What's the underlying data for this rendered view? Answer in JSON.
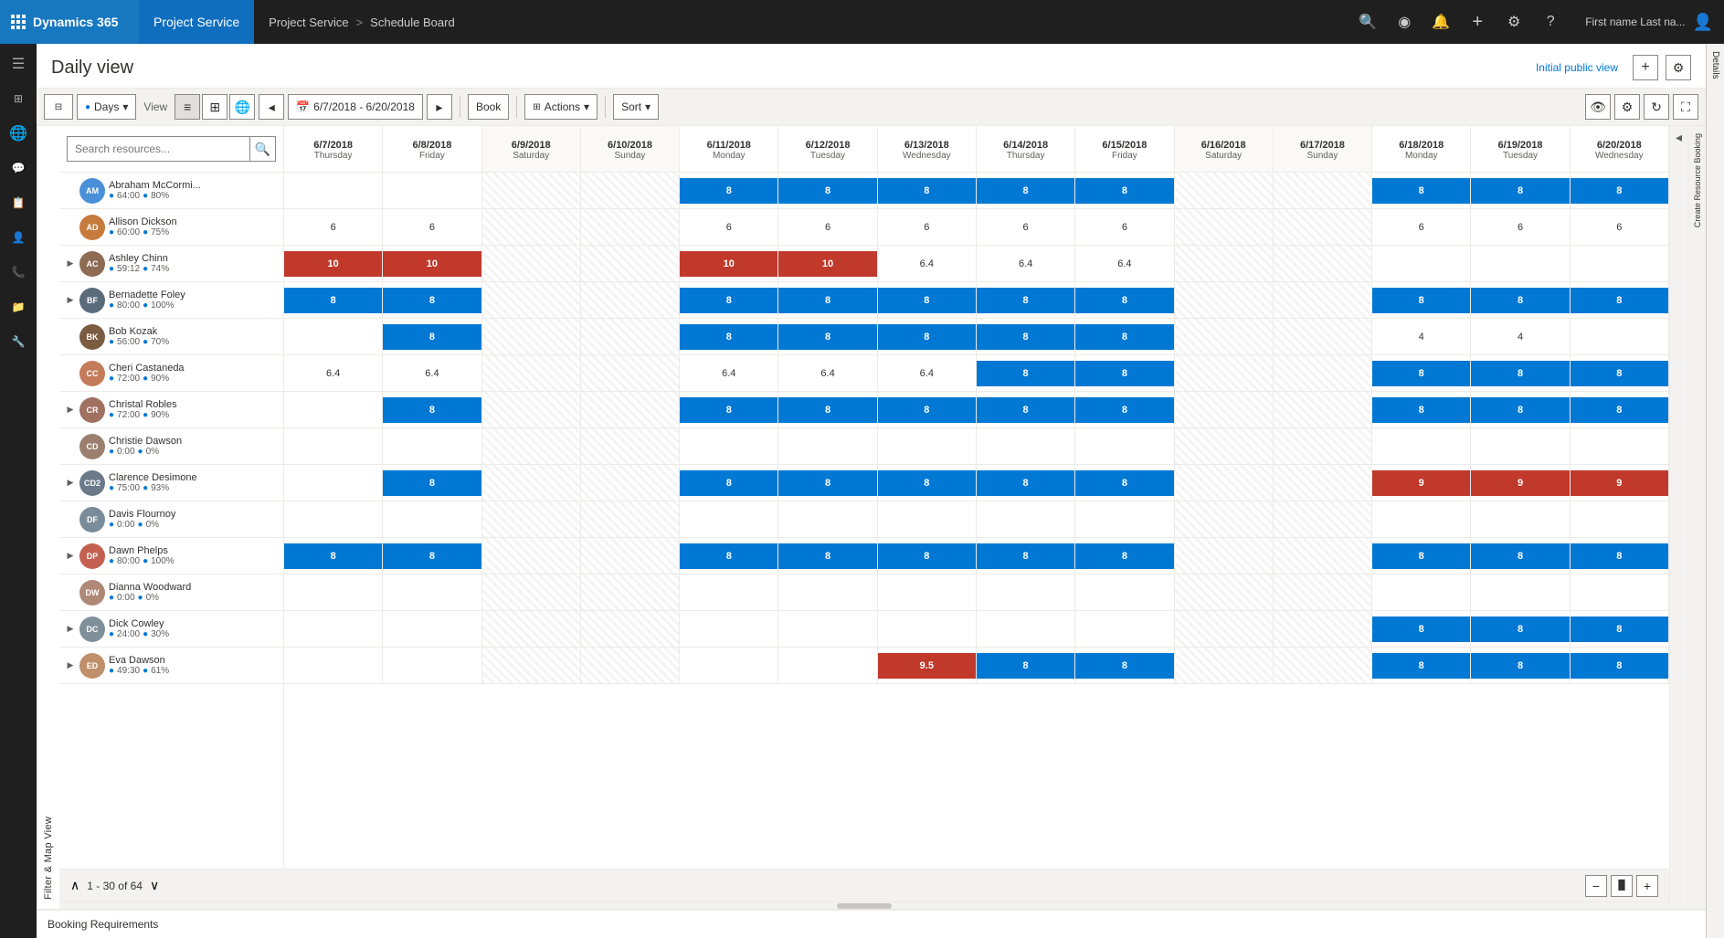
{
  "topnav": {
    "brand": "Dynamics 365",
    "module": "Project Service",
    "breadcrumb_part1": "Project Service",
    "breadcrumb_sep": ">",
    "breadcrumb_part2": "Schedule Board",
    "user": "First name Last na...",
    "icons": {
      "search": "🔍",
      "circle": "◎",
      "bell": "🔔",
      "plus": "＋",
      "gear": "⚙",
      "help": "？"
    }
  },
  "page": {
    "title": "Daily view",
    "initial_public_label": "Initial public view",
    "add_view_icon": "+",
    "settings_icon": "⚙"
  },
  "toolbar": {
    "days_label": "Days",
    "view_label": "View",
    "book_label": "Book",
    "actions_label": "Actions",
    "sort_label": "Sort",
    "date_range": "6/7/2018 - 6/20/2018"
  },
  "resource_search": {
    "placeholder": "Search resources..."
  },
  "dates": [
    {
      "date": "6/7/2018",
      "day": "Thursday",
      "weekend": false
    },
    {
      "date": "6/8/2018",
      "day": "Friday",
      "weekend": false
    },
    {
      "date": "6/9/2018",
      "day": "Saturday",
      "weekend": true
    },
    {
      "date": "6/10/2018",
      "day": "Sunday",
      "weekend": true
    },
    {
      "date": "6/11/2018",
      "day": "Monday",
      "weekend": false
    },
    {
      "date": "6/12/2018",
      "day": "Tuesday",
      "weekend": false
    },
    {
      "date": "6/13/2018",
      "day": "Wednesday",
      "weekend": false
    },
    {
      "date": "6/14/2018",
      "day": "Thursday",
      "weekend": false
    },
    {
      "date": "6/15/2018",
      "day": "Friday",
      "weekend": false
    },
    {
      "date": "6/16/2018",
      "day": "Saturday",
      "weekend": true
    },
    {
      "date": "6/17/2018",
      "day": "Sunday",
      "weekend": true
    },
    {
      "date": "6/18/2018",
      "day": "Monday",
      "weekend": false
    },
    {
      "date": "6/19/2018",
      "day": "Tuesday",
      "weekend": false
    },
    {
      "date": "6/20/2018",
      "day": "Wednesday",
      "weekend": false
    }
  ],
  "resources": [
    {
      "name": "Abraham McCormi...",
      "hours": "64:00",
      "percent": "80%",
      "initials": "AM",
      "color": "#4a90d9",
      "bookings": [
        null,
        null,
        null,
        null,
        "8",
        "8",
        "8",
        "8",
        "8",
        null,
        null,
        "8",
        "8",
        "8"
      ],
      "booking_types": [
        null,
        null,
        null,
        null,
        "blue",
        "blue",
        "blue",
        "blue",
        "blue",
        null,
        null,
        "blue",
        "blue",
        "blue"
      ],
      "has_expand": false
    },
    {
      "name": "Allison Dickson",
      "hours": "60:00",
      "percent": "75%",
      "initials": "AD",
      "color": "#c67b3c",
      "bookings": [
        "6",
        "6",
        null,
        null,
        "6",
        "6",
        "6",
        "6",
        "6",
        null,
        null,
        "6",
        "6",
        "6"
      ],
      "booking_types": [
        null,
        null,
        null,
        null,
        null,
        null,
        null,
        null,
        null,
        null,
        null,
        null,
        null,
        null
      ],
      "has_expand": false
    },
    {
      "name": "Ashley Chinn",
      "hours": "59:12",
      "percent": "74%",
      "initials": "AC",
      "color": "#8e6b52",
      "bookings": [
        "10",
        "10",
        null,
        null,
        "10",
        "10",
        "6.4",
        "6.4",
        "6.4",
        null,
        null,
        null,
        null,
        null
      ],
      "booking_types": [
        "red",
        "red",
        null,
        null,
        "red",
        "red",
        null,
        null,
        null,
        null,
        null,
        null,
        null,
        null
      ],
      "has_expand": true
    },
    {
      "name": "Bernadette Foley",
      "hours": "80:00",
      "percent": "100%",
      "initials": "BF",
      "color": "#5a6b7c",
      "bookings": [
        "8",
        "8",
        null,
        null,
        "8",
        "8",
        "8",
        "8",
        "8",
        null,
        null,
        "8",
        "8",
        "8"
      ],
      "booking_types": [
        "blue",
        "blue",
        null,
        null,
        "blue",
        "blue",
        "blue",
        "blue",
        "blue",
        null,
        null,
        "blue",
        "blue",
        "blue"
      ],
      "has_expand": true
    },
    {
      "name": "Bob Kozak",
      "hours": "56:00",
      "percent": "70%",
      "initials": "BK",
      "color": "#7a5c40",
      "bookings": [
        null,
        "8",
        null,
        null,
        "8",
        "8",
        "8",
        "8",
        "8",
        null,
        null,
        "4",
        "4",
        null
      ],
      "booking_types": [
        null,
        "blue",
        null,
        null,
        "blue",
        "blue",
        "blue",
        "blue",
        "blue",
        null,
        null,
        null,
        null,
        null
      ],
      "has_expand": false
    },
    {
      "name": "Cheri Castaneda",
      "hours": "72:00",
      "percent": "90%",
      "initials": "CC",
      "color": "#c47b5a",
      "bookings": [
        "6.4",
        "6.4",
        null,
        null,
        "6.4",
        "6.4",
        "6.4",
        "8",
        "8",
        null,
        null,
        "8",
        "8",
        "8"
      ],
      "booking_types": [
        null,
        null,
        null,
        null,
        null,
        null,
        null,
        "blue",
        "blue",
        null,
        null,
        "blue",
        "blue",
        "blue"
      ],
      "has_expand": false
    },
    {
      "name": "Christal Robles",
      "hours": "72:00",
      "percent": "90%",
      "initials": "CR",
      "color": "#a07060",
      "bookings": [
        null,
        "8",
        null,
        null,
        "8",
        "8",
        "8",
        "8",
        "8",
        null,
        null,
        "8",
        "8",
        "8"
      ],
      "booking_types": [
        null,
        "blue",
        null,
        null,
        "blue",
        "blue",
        "blue",
        "blue",
        "blue",
        null,
        null,
        "blue",
        "blue",
        "blue"
      ],
      "has_expand": true
    },
    {
      "name": "Christie Dawson",
      "hours": "0:00",
      "percent": "0%",
      "initials": "CD",
      "color": "#9b8070",
      "bookings": [
        null,
        null,
        null,
        null,
        null,
        null,
        null,
        null,
        null,
        null,
        null,
        null,
        null,
        null
      ],
      "booking_types": [
        null,
        null,
        null,
        null,
        null,
        null,
        null,
        null,
        null,
        null,
        null,
        null,
        null,
        null
      ],
      "has_expand": false
    },
    {
      "name": "Clarence Desimone",
      "hours": "75:00",
      "percent": "93%",
      "initials": "CD2",
      "color": "#6b7a8a",
      "bookings": [
        null,
        "8",
        null,
        null,
        "8",
        "8",
        "8",
        "8",
        "8",
        null,
        null,
        "9",
        "9",
        "9"
      ],
      "booking_types": [
        null,
        "blue",
        null,
        null,
        "blue",
        "blue",
        "blue",
        "blue",
        "blue",
        null,
        null,
        "red",
        "red",
        "red"
      ],
      "has_expand": true
    },
    {
      "name": "Davis Flournoy",
      "hours": "0:00",
      "percent": "0%",
      "initials": "DF",
      "color": "#7a8c9a",
      "bookings": [
        null,
        null,
        null,
        null,
        null,
        null,
        null,
        null,
        null,
        null,
        null,
        null,
        null,
        null
      ],
      "booking_types": [
        null,
        null,
        null,
        null,
        null,
        null,
        null,
        null,
        null,
        null,
        null,
        null,
        null,
        null
      ],
      "has_expand": false
    },
    {
      "name": "Dawn Phelps",
      "hours": "80:00",
      "percent": "100%",
      "initials": "DP",
      "color": "#c46050",
      "bookings": [
        "8",
        "8",
        null,
        null,
        "8",
        "8",
        "8",
        "8",
        "8",
        null,
        null,
        "8",
        "8",
        "8"
      ],
      "booking_types": [
        "blue",
        "blue",
        null,
        null,
        "blue",
        "blue",
        "blue",
        "blue",
        "blue",
        null,
        null,
        "blue",
        "blue",
        "blue"
      ],
      "has_expand": true
    },
    {
      "name": "Dianna Woodward",
      "hours": "0:00",
      "percent": "0%",
      "initials": "DW",
      "color": "#b08878",
      "bookings": [
        null,
        null,
        null,
        null,
        null,
        null,
        null,
        null,
        null,
        null,
        null,
        null,
        null,
        null
      ],
      "booking_types": [
        null,
        null,
        null,
        null,
        null,
        null,
        null,
        null,
        null,
        null,
        null,
        null,
        null,
        null
      ],
      "has_expand": false
    },
    {
      "name": "Dick Cowley",
      "hours": "24:00",
      "percent": "30%",
      "initials": "DC",
      "color": "#80909a",
      "bookings": [
        null,
        null,
        null,
        null,
        null,
        null,
        null,
        null,
        null,
        null,
        null,
        "8",
        "8",
        "8"
      ],
      "booking_types": [
        null,
        null,
        null,
        null,
        null,
        null,
        null,
        null,
        null,
        null,
        null,
        "blue",
        "blue",
        "blue"
      ],
      "has_expand": true
    },
    {
      "name": "Eva Dawson",
      "hours": "49:30",
      "percent": "61%",
      "initials": "ED",
      "color": "#c0906a",
      "bookings": [
        null,
        null,
        null,
        null,
        null,
        null,
        "9.5",
        "8",
        "8",
        null,
        null,
        "8",
        "8",
        "8"
      ],
      "booking_types": [
        null,
        null,
        null,
        null,
        null,
        null,
        "red",
        "blue",
        "blue",
        null,
        null,
        "blue",
        "blue",
        "blue"
      ],
      "has_expand": true
    }
  ],
  "pagination": {
    "label": "1 - 30 of 64",
    "expand_icon": "∧",
    "collapse_icon": "∨"
  },
  "sidebar_left": {
    "icons": [
      "☰",
      "📊",
      "🌐",
      "💬",
      "📋",
      "👤",
      "📞",
      "📁",
      "🔧"
    ]
  },
  "right_panels": {
    "details_label": "Details",
    "create_resource_booking_label": "Create Resource Booking"
  },
  "booking_requirements": {
    "label": "Booking Requirements"
  },
  "colors": {
    "blue_booking": "#0078d4",
    "red_booking": "#c0392b",
    "nav_dark": "#1f1f1f",
    "nav_blue": "#106ebe",
    "brand_blue": "#1778bf"
  }
}
